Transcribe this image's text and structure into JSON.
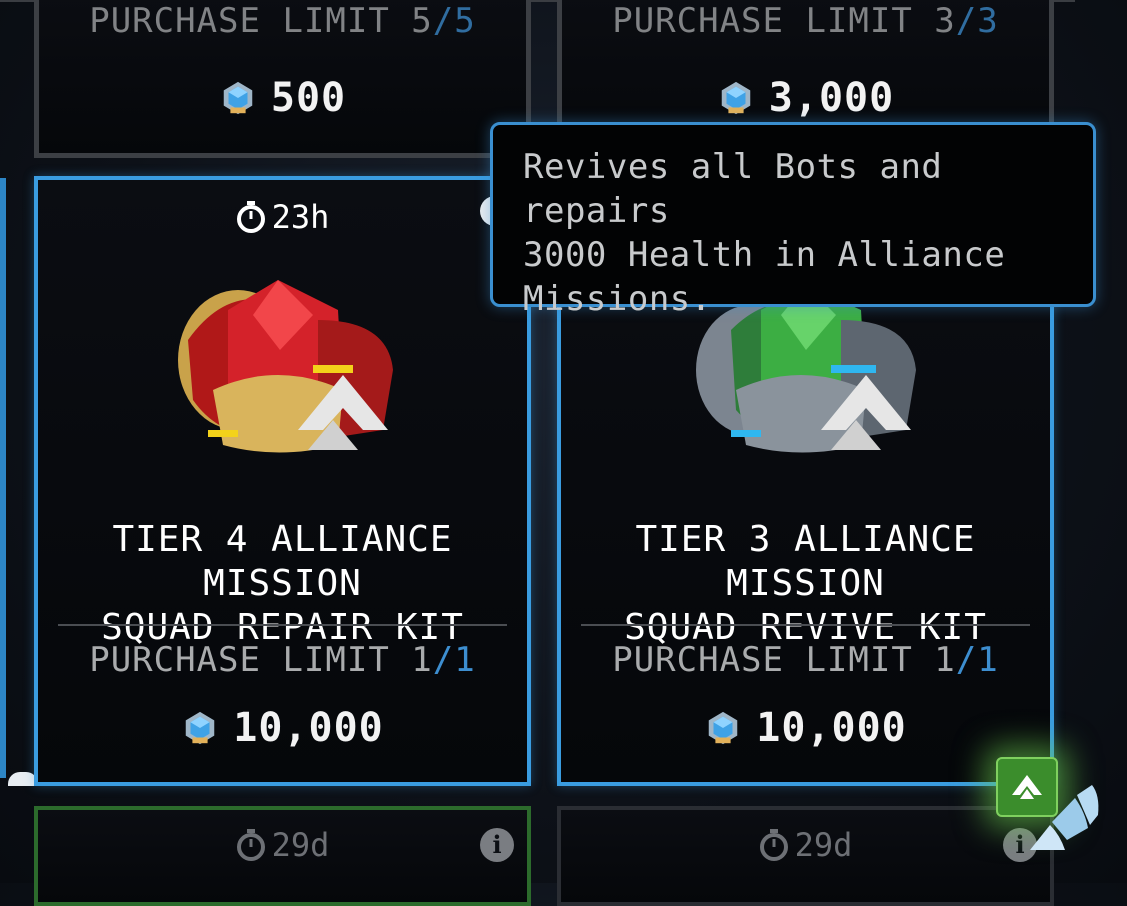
{
  "top_row": [
    {
      "purchase_limit_label": "PURCHASE LIMIT",
      "count": "5",
      "slash": "/",
      "max": "5",
      "price": "500",
      "currency_icon": "crystal-gem-icon"
    },
    {
      "purchase_limit_label": "PURCHASE LIMIT",
      "count": "3",
      "slash": "/",
      "max": "3",
      "price": "3,000",
      "currency_icon": "crystal-gem-icon"
    }
  ],
  "middle_row": [
    {
      "timer": "23h",
      "timer_icon": "stopwatch-icon",
      "title_line1": "TIER 4 ALLIANCE MISSION",
      "title_line2": "SQUAD REPAIR KIT",
      "purchase_limit_label": "PURCHASE LIMIT",
      "count": "1",
      "slash": "/",
      "max": "1",
      "price": "10,000",
      "item_icon": "red-gold-repair-kit-icon"
    },
    {
      "title_line1": "TIER 3 ALLIANCE MISSION",
      "title_line2": "SQUAD REVIVE KIT",
      "purchase_limit_label": "PURCHASE LIMIT",
      "count": "1",
      "slash": "/",
      "max": "1",
      "price": "10,000",
      "item_icon": "green-gray-revive-kit-icon"
    }
  ],
  "bottom_row": [
    {
      "timer": "29d",
      "timer_icon": "stopwatch-icon",
      "info_icon": "info-icon",
      "info_glyph": "i"
    },
    {
      "timer": "29d",
      "timer_icon": "stopwatch-icon",
      "info_icon": "info-icon",
      "info_glyph": "i"
    }
  ],
  "tooltip": {
    "line1": "Revives all Bots and repairs",
    "line2": "3000 Health in Alliance",
    "line3": "Missions."
  },
  "colors": {
    "selected_border": "#3a9ce0",
    "limit_accent": "#3d8ed0",
    "green_button": "#3b8d2c"
  }
}
